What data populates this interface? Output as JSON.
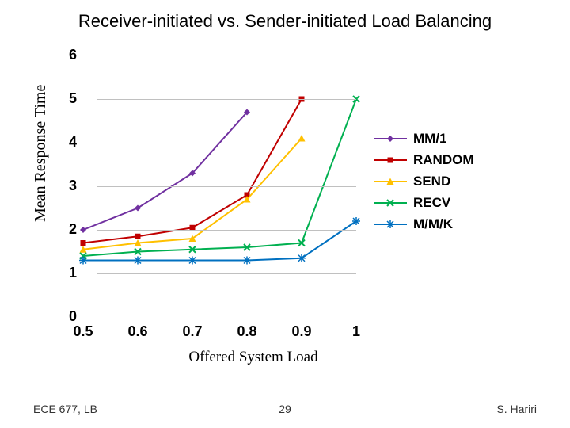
{
  "title": "Receiver-initiated vs. Sender-initiated Load Balancing",
  "ylabel": "Mean Response Time",
  "xlabel": "Offered System Load",
  "footer": {
    "left": "ECE 677, LB",
    "center": "29",
    "right": "S. Hariri"
  },
  "legend": {
    "items": [
      {
        "name": "MM/1",
        "color": "#7030A0"
      },
      {
        "name": "RANDOM",
        "color": "#C00000"
      },
      {
        "name": "SEND",
        "color": "#FFC000"
      },
      {
        "name": "RECV",
        "color": "#00B050"
      },
      {
        "name": "M/M/K",
        "color": "#0070C0"
      }
    ]
  },
  "chart_data": {
    "type": "line",
    "xlabel": "Offered System Load",
    "ylabel": "Mean Response Time",
    "title": "Receiver-initiated vs. Sender-initiated Load Balancing",
    "x": [
      0.5,
      0.6,
      0.7,
      0.8,
      0.9,
      1.0
    ],
    "xlim": [
      0.5,
      1.0
    ],
    "ylim": [
      0,
      6
    ],
    "yticks": [
      0,
      1,
      2,
      3,
      4,
      5,
      6
    ],
    "series": [
      {
        "name": "MM/1",
        "color": "#7030A0",
        "values": [
          2.0,
          2.5,
          3.3,
          4.7,
          null,
          null
        ]
      },
      {
        "name": "RANDOM",
        "color": "#C00000",
        "values": [
          1.7,
          1.85,
          2.05,
          2.8,
          5.0,
          null
        ]
      },
      {
        "name": "SEND",
        "color": "#FFC000",
        "values": [
          1.55,
          1.7,
          1.8,
          2.7,
          4.1,
          null
        ]
      },
      {
        "name": "RECV",
        "color": "#00B050",
        "values": [
          1.4,
          1.5,
          1.55,
          1.6,
          1.7,
          5.0
        ]
      },
      {
        "name": "M/M/K",
        "color": "#0070C0",
        "values": [
          1.3,
          1.3,
          1.3,
          1.3,
          1.35,
          2.2
        ]
      }
    ]
  }
}
